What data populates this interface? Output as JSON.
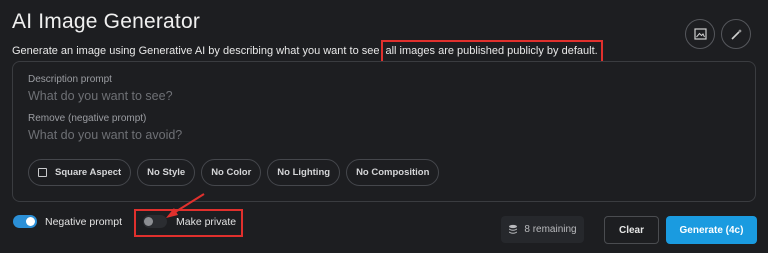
{
  "header": {
    "title": "AI Image Generator",
    "subtitle_prefix": "Generate an image using Generative AI by describing what you want to see",
    "subtitle_highlight": "all images are published publicly by default.",
    "icons": [
      "image-icon",
      "magic-wand-icon"
    ]
  },
  "prompt": {
    "description_label": "Description prompt",
    "description_placeholder": "What do you want to see?",
    "negative_label": "Remove (negative prompt)",
    "negative_placeholder": "What do you want to avoid?"
  },
  "chips": [
    {
      "label": "Square Aspect"
    },
    {
      "label": "No Style"
    },
    {
      "label": "No Color"
    },
    {
      "label": "No Lighting"
    },
    {
      "label": "No Composition"
    }
  ],
  "footer": {
    "negative_prompt_label": "Negative prompt",
    "negative_prompt_on": true,
    "make_private_label": "Make private",
    "make_private_on": false,
    "remaining": "8 remaining",
    "clear_label": "Clear",
    "generate_label": "Generate (4c)"
  },
  "colors": {
    "accent": "#1a9be0",
    "annotation_red": "#e0302d",
    "background": "#1d1e21"
  }
}
